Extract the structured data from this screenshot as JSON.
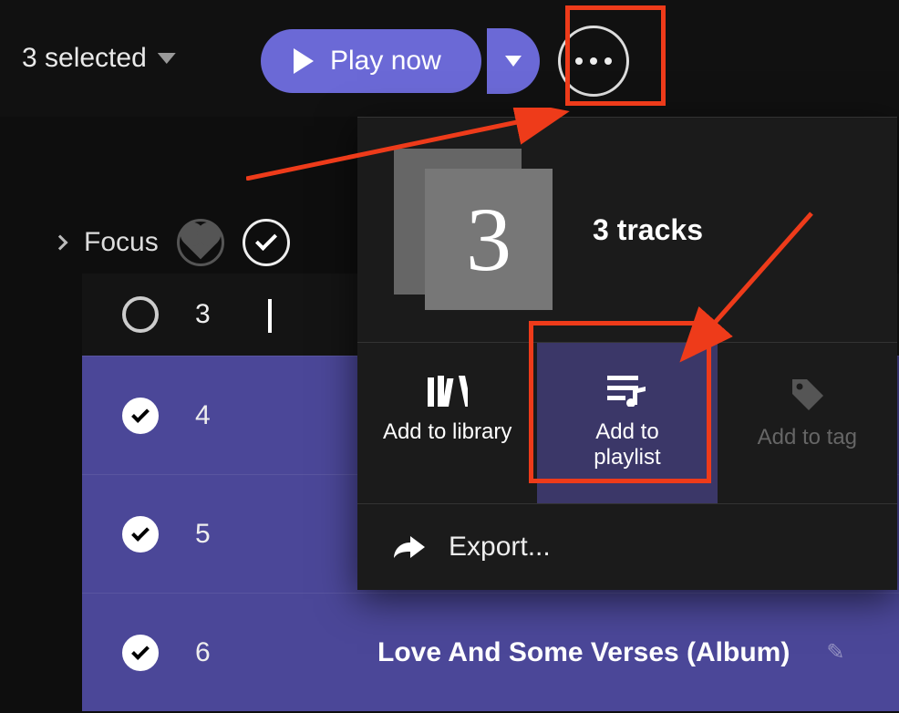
{
  "toolbar": {
    "selected_label": "3 selected",
    "play_label": "Play now"
  },
  "filters": {
    "focus_label": "Focus"
  },
  "tracks": [
    {
      "num": "3",
      "selected": false,
      "title": ""
    },
    {
      "num": "4",
      "selected": true,
      "title": ""
    },
    {
      "num": "5",
      "selected": true,
      "title": ""
    },
    {
      "num": "6",
      "selected": true,
      "title": "Love And Some Verses (Album)"
    }
  ],
  "panel": {
    "big_number": "3",
    "subtitle": "3 tracks",
    "actions": {
      "library": "Add to library",
      "playlist": "Add to playlist",
      "tag": "Add to tag"
    },
    "export_label": "Export..."
  }
}
